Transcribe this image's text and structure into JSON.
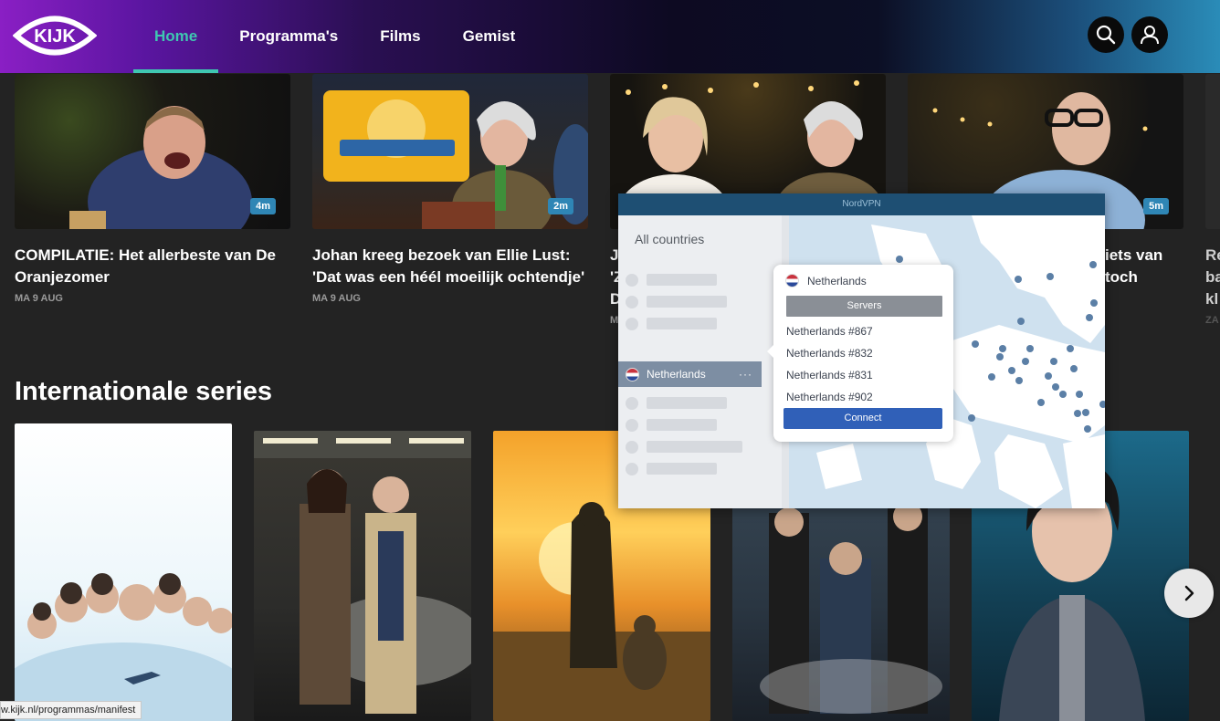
{
  "header": {
    "logo_text": "KIJK",
    "nav": [
      {
        "label": "Home",
        "active": true
      },
      {
        "label": "Programma's",
        "active": false
      },
      {
        "label": "Films",
        "active": false
      },
      {
        "label": "Gemist",
        "active": false
      }
    ],
    "icons": {
      "search": "search-icon",
      "account": "user-icon"
    }
  },
  "videos": [
    {
      "title": "COMPILATIE: Het allerbeste van De Oranjezomer",
      "date": "MA 9 AUG",
      "duration": "4m"
    },
    {
      "title": "Johan kreeg bezoek van Ellie Lust: 'Dat was een héél moeilijk ochtendje'",
      "date": "MA 9 AUG",
      "duration": "2m"
    },
    {
      "title": "Jo 'Z D",
      "date": "M",
      "duration": ""
    },
    {
      "title": "iets van toch",
      "date": "",
      "duration": "5m"
    },
    {
      "title": "Re ba kl",
      "date": "ZA"
    }
  ],
  "section": {
    "title": "Internationale series"
  },
  "status_url": "w.kijk.nl/programmas/manifest",
  "vpn": {
    "window_title": "NordVPN",
    "sidebar_title": "All countries",
    "selected_country": "Netherlands",
    "more_label": "···",
    "popup": {
      "country": "Netherlands",
      "servers_label": "Servers",
      "servers": [
        "Netherlands #867",
        "Netherlands #832",
        "Netherlands #831",
        "Netherlands #902"
      ],
      "connect_label": "Connect"
    }
  },
  "colors": {
    "accent": "#3fc7b1",
    "duration_badge": "#2f86b5",
    "vpn_connect": "#3060b8"
  }
}
